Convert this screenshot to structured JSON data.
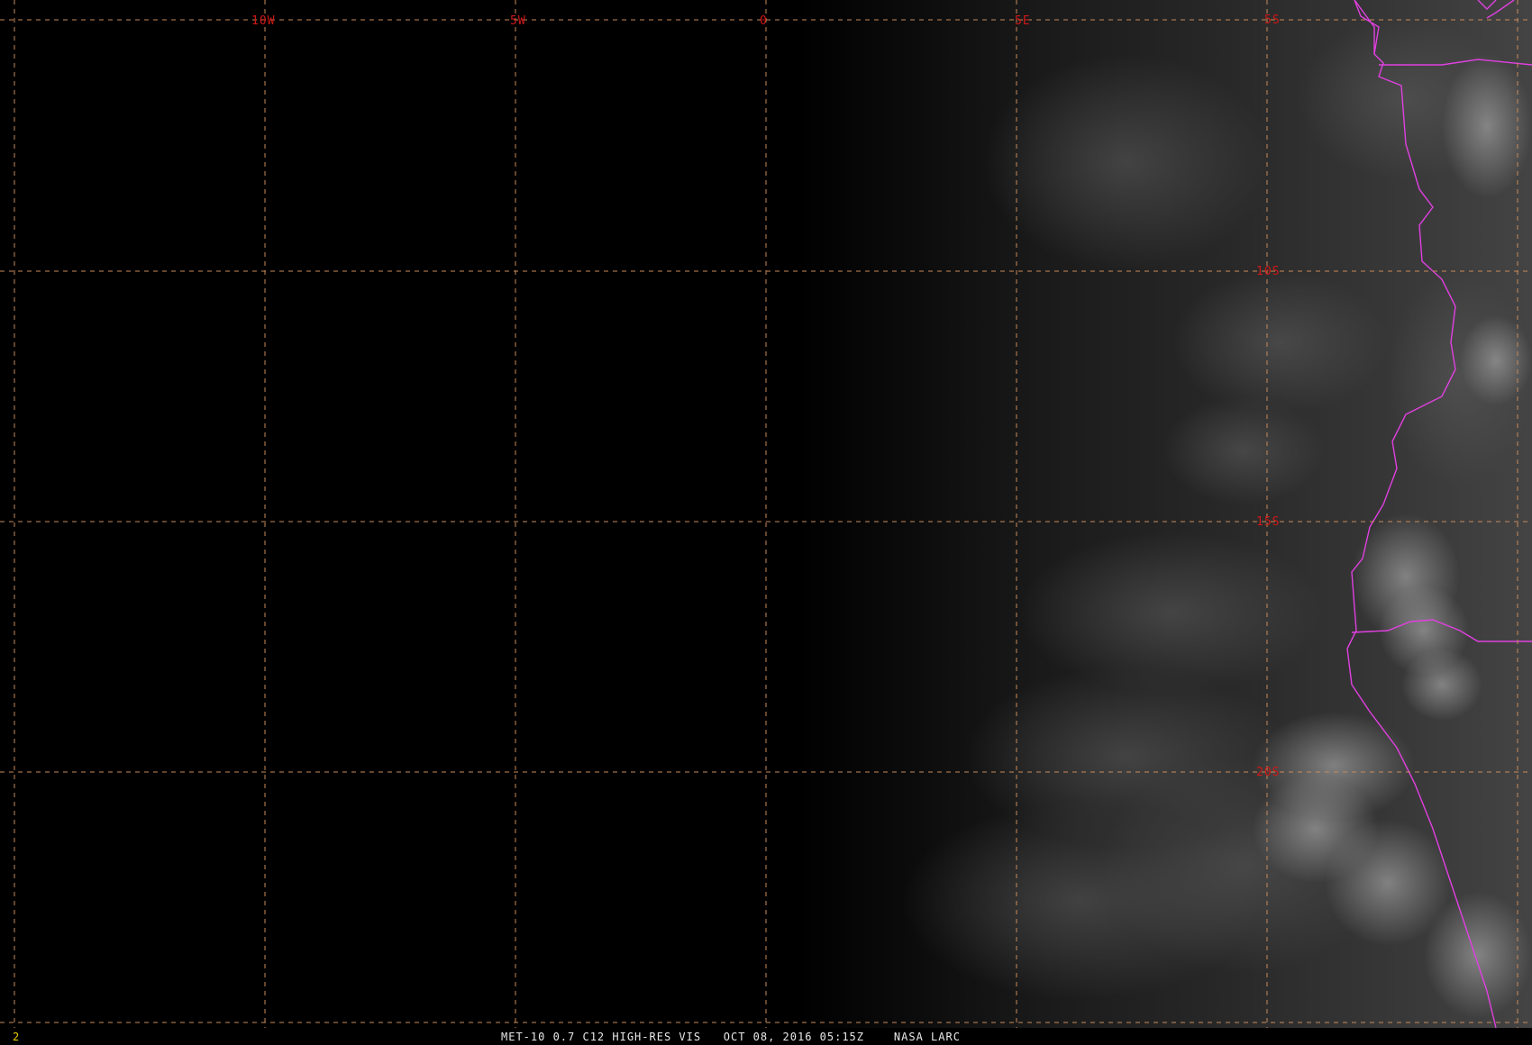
{
  "colors": {
    "background": "#000000",
    "grid_line": "#c98a5a",
    "grid_label": "#d01818",
    "border_line": "#e040e0",
    "caption_text": "#e8e8e8",
    "frame_number_text": "#e8d000"
  },
  "map": {
    "projection": "latitude-longitude",
    "imagery": "visible satellite, night-side dark left, clouds over south-west Africa coast",
    "longitude_labels": [
      "10W",
      "5W",
      "0",
      "5E"
    ],
    "latitude_labels": [
      "5S",
      "10S",
      "15S",
      "20S"
    ],
    "grid_line_style": "dashed"
  },
  "footer": {
    "frame_number": "2",
    "caption": "MET-10 0.7 C12 HIGH-RES VIS   OCT 08, 2016 05:15Z    NASA LARC"
  }
}
